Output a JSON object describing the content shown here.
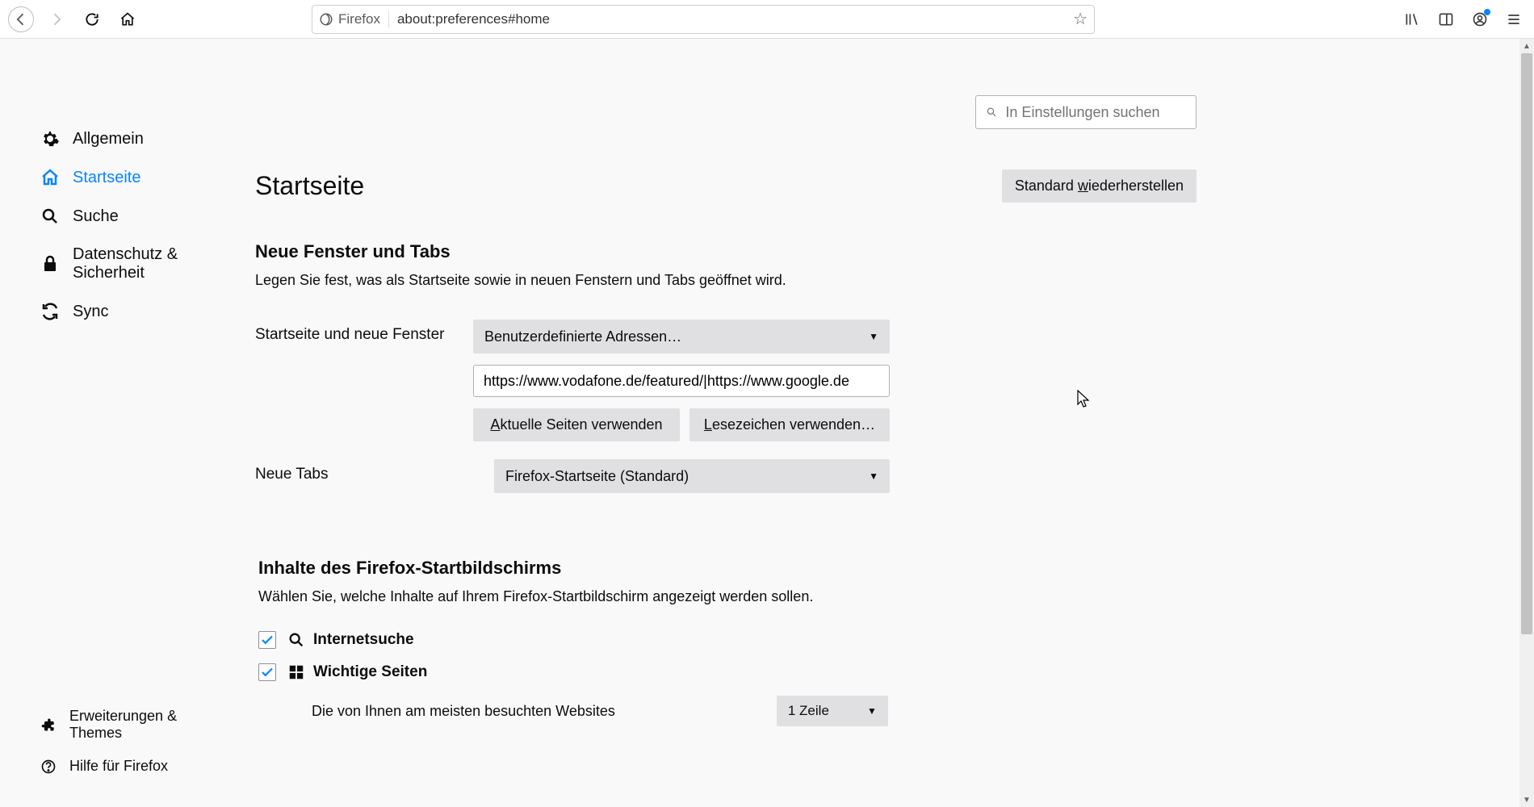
{
  "toolbar": {
    "identity_label": "Firefox",
    "url": "about:preferences#home"
  },
  "search": {
    "placeholder": "In Einstellungen suchen"
  },
  "sidebar": {
    "items": [
      {
        "label": "Allgemein"
      },
      {
        "label": "Startseite"
      },
      {
        "label": "Suche"
      },
      {
        "label": "Datenschutz & Sicherheit"
      },
      {
        "label": "Sync"
      }
    ],
    "bottom": [
      {
        "label": "Erweiterungen & Themes"
      },
      {
        "label": "Hilfe für Firefox"
      }
    ]
  },
  "page": {
    "title": "Startseite",
    "restore_btn_pre": "Standard ",
    "restore_btn_ul": "w",
    "restore_btn_post": "iederherstellen",
    "section1_title": "Neue Fenster und Tabs",
    "section1_desc": "Legen Sie fest, was als Startseite sowie in neuen Fenstern und Tabs geöffnet wird.",
    "homepage_label": "Startseite und neue Fenster",
    "homepage_select": "Benutzerdefinierte Adressen…",
    "homepage_url": "https://www.vodafone.de/featured/|https://www.google.de",
    "use_current_ul": "A",
    "use_current_post": "ktuelle Seiten verwenden",
    "use_bookmark_ul": "L",
    "use_bookmark_post": "esezeichen verwenden…",
    "newtabs_label": "Neue Tabs",
    "newtabs_select": "Firefox-Startseite (Standard)",
    "section2_title": "Inhalte des Firefox-Startbildschirms",
    "section2_desc": "Wählen Sie, welche Inhalte auf Ihrem Firefox-Startbildschirm angezeigt werden sollen.",
    "check1": "Internetsuche",
    "check2": "Wichtige Seiten",
    "check2_desc": "Die von Ihnen am meisten besuchten Websites",
    "rows_select": "1 Zeile"
  }
}
